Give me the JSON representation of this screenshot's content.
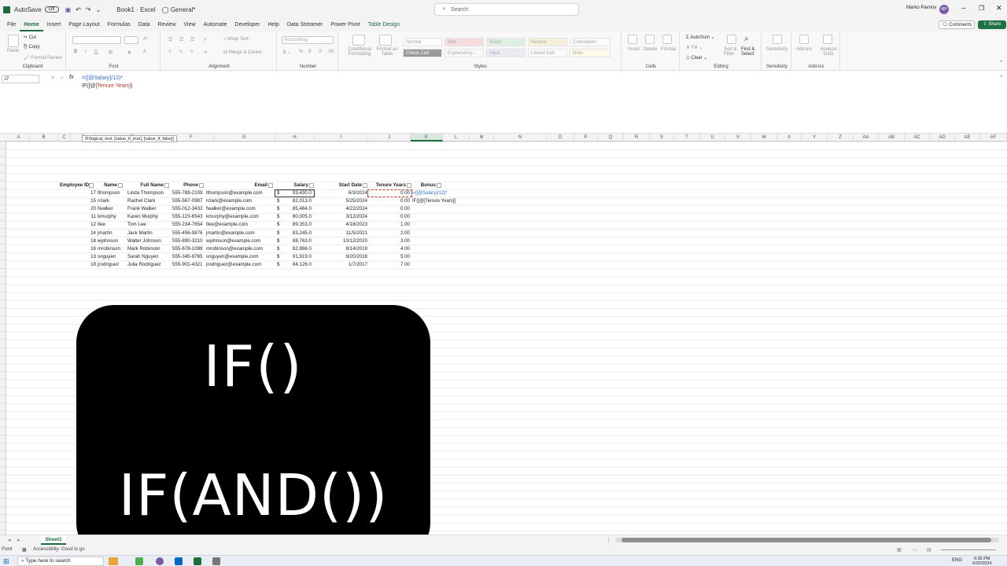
{
  "titlebar": {
    "autosave_label": "AutoSave",
    "autosave_state": "Off",
    "document_title": "Book1 · Excel",
    "sensitivity": "General*",
    "search_placeholder": "Search",
    "user_name": "Marko Pavnov",
    "user_initials": "MP"
  },
  "tabs": [
    "File",
    "Home",
    "Insert",
    "Page Layout",
    "Formulas",
    "Data",
    "Review",
    "View",
    "Automate",
    "Developer",
    "Help",
    "Data Streamer",
    "Power Pivot",
    "Table Design"
  ],
  "actions": {
    "comments": "Comments",
    "share": "Share"
  },
  "ribbon": {
    "clipboard": {
      "label": "Clipboard",
      "paste": "Paste",
      "cut": "Cut",
      "copy": "Copy",
      "format_painter": "Format Painter"
    },
    "font": {
      "label": "Font"
    },
    "alignment": {
      "label": "Alignment",
      "wrap": "Wrap Text",
      "merge": "Merge & Center"
    },
    "number": {
      "label": "Number",
      "format": "Accounting"
    },
    "styles": {
      "label": "Styles",
      "cond": "Conditional Formatting",
      "fmt_table": "Format as Table",
      "cells_row1": [
        "Normal",
        "Bad",
        "Good",
        "Neutral",
        "Calculation"
      ],
      "cells_row2": [
        "Check Cell",
        "Explanatory...",
        "Input",
        "Linked Cell",
        "Note"
      ]
    },
    "cells": {
      "label": "Cells",
      "insert": "Insert",
      "delete": "Delete",
      "format": "Format"
    },
    "editing": {
      "label": "Editing",
      "autosum": "AutoSum",
      "fill": "Fill",
      "clear": "Clear",
      "sort": "Sort & Filter",
      "find": "Find & Select"
    },
    "sensitivity": {
      "label": "Sensitivity",
      "btn": "Sensitivity"
    },
    "addins": {
      "label": "Add-ins",
      "btn": "Add-ins",
      "analyze": "Analyze Data"
    }
  },
  "formula_bar": {
    "name_box": "J7",
    "fx": "fx",
    "line1_prefix": "=([@Salary]/12)*",
    "line2_prefix": "IF([@",
    "line2_ref": "[Tenure Years]",
    "tooltip": "IF(logical_test, [value_if_true], [value_if_false])"
  },
  "columns": [
    "A",
    "B",
    "C",
    "D",
    "E",
    "F",
    "G",
    "H",
    "I",
    "J",
    "K",
    "L",
    "M",
    "N",
    "O",
    "P",
    "Q",
    "R",
    "S",
    "T",
    "U",
    "V",
    "W",
    "X",
    "Y",
    "Z",
    "AA",
    "AB",
    "AC",
    "AD",
    "AE",
    "AF"
  ],
  "table": {
    "headers": [
      "Employee ID",
      "Name",
      "Full Name",
      "Phone",
      "Email",
      "Salary",
      "Start Date",
      "Tenure Years",
      "Bonus"
    ],
    "rows": [
      [
        "17",
        "lthompson",
        "Linda Thompson",
        "555-789-2109",
        "lthompson@example.com",
        "$",
        "93,430.0",
        "6/3/2024",
        "0.00"
      ],
      [
        "15",
        "rclark",
        "Rachel Clark",
        "555-567-0987",
        "rclark@example.com",
        "$",
        "82,013.0",
        "5/25/2024",
        "0.00"
      ],
      [
        "20",
        "fwalker",
        "Frank Walker",
        "555-012-3432",
        "fwalker@example.com",
        "$",
        "85,464.0",
        "4/22/2024",
        "0.00"
      ],
      [
        "11",
        "kmurphy",
        "Karen Murphy",
        "555-123-6543",
        "kmurphy@example.com",
        "$",
        "80,005.0",
        "3/12/2024",
        "0.00"
      ],
      [
        "12",
        "tlee",
        "Tom Lee",
        "555-234-7654",
        "tlee@example.com",
        "$",
        "89,353.0",
        "4/18/2023",
        "1.00"
      ],
      [
        "14",
        "jmartin",
        "Jack Martin",
        "555-456-9876",
        "jmartin@example.com",
        "$",
        "83,245.0",
        "11/5/2021",
        "2.00"
      ],
      [
        "18",
        "wjohnson",
        "Walter Johnson",
        "555-890-3210",
        "wjohnson@example.com",
        "$",
        "88,763.0",
        "10/12/2020",
        "3.00"
      ],
      [
        "16",
        "mrobinson",
        "Mark Robinson",
        "555-678-1098",
        "mrobinson@example.com",
        "$",
        "82,866.0",
        "8/14/2019",
        "4.00"
      ],
      [
        "13",
        "snguyen",
        "Sarah Nguyen",
        "555-345-8765",
        "snguyen@example.com",
        "$",
        "91,919.0",
        "9/20/2018",
        "5.00"
      ],
      [
        "19",
        "jrodriguez",
        "Julia Rodriguez",
        "555-901-4321",
        "jrodriguez@example.com",
        "$",
        "84,126.0",
        "1/7/2017",
        "7.00"
      ]
    ],
    "bonus_edit_line1": "=([@Salary]/12)*",
    "bonus_edit_line2": "IF([@[Tenure Years]]"
  },
  "overlay": {
    "line1": "IF()",
    "line2": "IF(AND())"
  },
  "sheet_tab": "Sheet1",
  "status": {
    "mode": "Point",
    "accessibility": "Accessibility: Good to go"
  },
  "taskbar": {
    "search": "Type here to search",
    "lang": "ENG",
    "time": "6:35 PM",
    "date": "6/20/2024"
  }
}
